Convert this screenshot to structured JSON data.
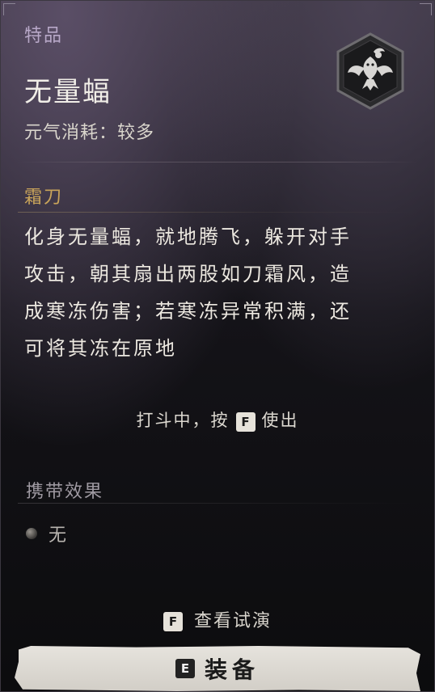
{
  "item": {
    "rarity": "特品",
    "name": "无量蝠",
    "cost": "元气消耗：较多",
    "icon": "winged-bat-spirit-icon"
  },
  "skill": {
    "name": "霜刀",
    "description_lines": [
      "化身无量蝠，就地腾飞，躲开对手",
      "攻击，朝其扇出两股如刀霜风，造",
      "成寒冻伤害；若寒冻异常积满，还",
      "可将其冻在原地"
    ]
  },
  "usage_hint": {
    "before": "打斗中，按",
    "key": "F",
    "after": "使出"
  },
  "carry": {
    "label": "携带效果",
    "items": [
      "无"
    ]
  },
  "actions": {
    "preview": {
      "key": "F",
      "label": "查看试演"
    },
    "equip": {
      "key": "E",
      "label": "装备"
    }
  },
  "colors": {
    "rarity": "#b8a8c8",
    "skill_name": "#c9a45a",
    "button_bg": "#e0ddd7"
  }
}
